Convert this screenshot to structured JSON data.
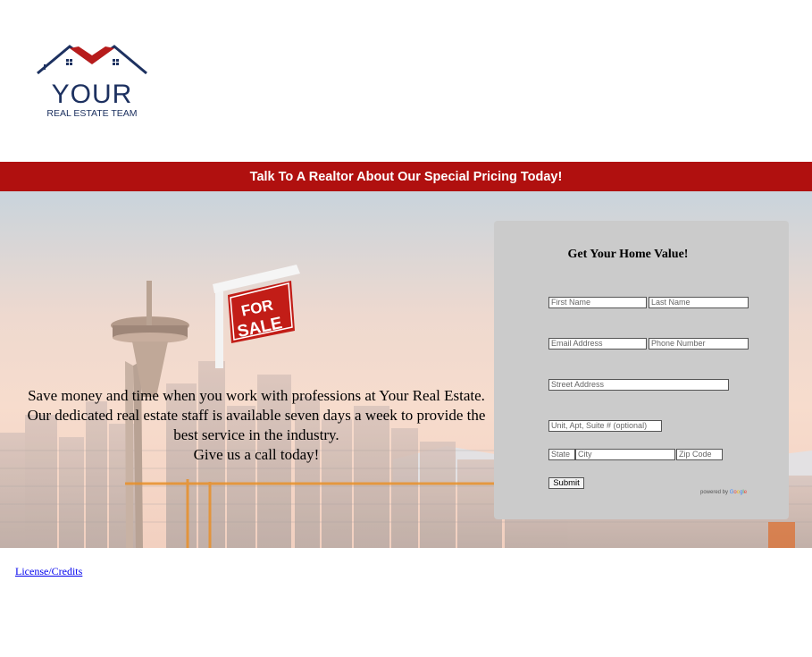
{
  "logo": {
    "main_text": "YOUR",
    "sub_text": "REAL ESTATE TEAM",
    "colors": {
      "navy": "#1d3160",
      "red": "#b71c1c"
    }
  },
  "banner": {
    "text": "Talk To A Realtor About Our Special Pricing Today!",
    "color": "#b0100f"
  },
  "hero": {
    "sign_text_1": "FOR",
    "sign_text_2": "SALE",
    "paragraph": "Save money and time when you work with professions at Your Real Estate. Our dedicated real estate staff is available seven days a week to provide the best service in the industry.",
    "cta": "Give us a call today!"
  },
  "form": {
    "title": "Get Your Home Value!",
    "fields": {
      "first_name": "First Name",
      "last_name": "Last Name",
      "email": "Email Address",
      "phone": "Phone Number",
      "street": "Street Address",
      "unit": "Unit, Apt, Suite # (optional)",
      "state": "State",
      "city": "City",
      "zip": "Zip Code"
    },
    "submit_label": "Submit",
    "powered_by": "powered by",
    "google": [
      "G",
      "o",
      "o",
      "g",
      "l",
      "e"
    ]
  },
  "footer": {
    "license_link": "License/Credits"
  }
}
